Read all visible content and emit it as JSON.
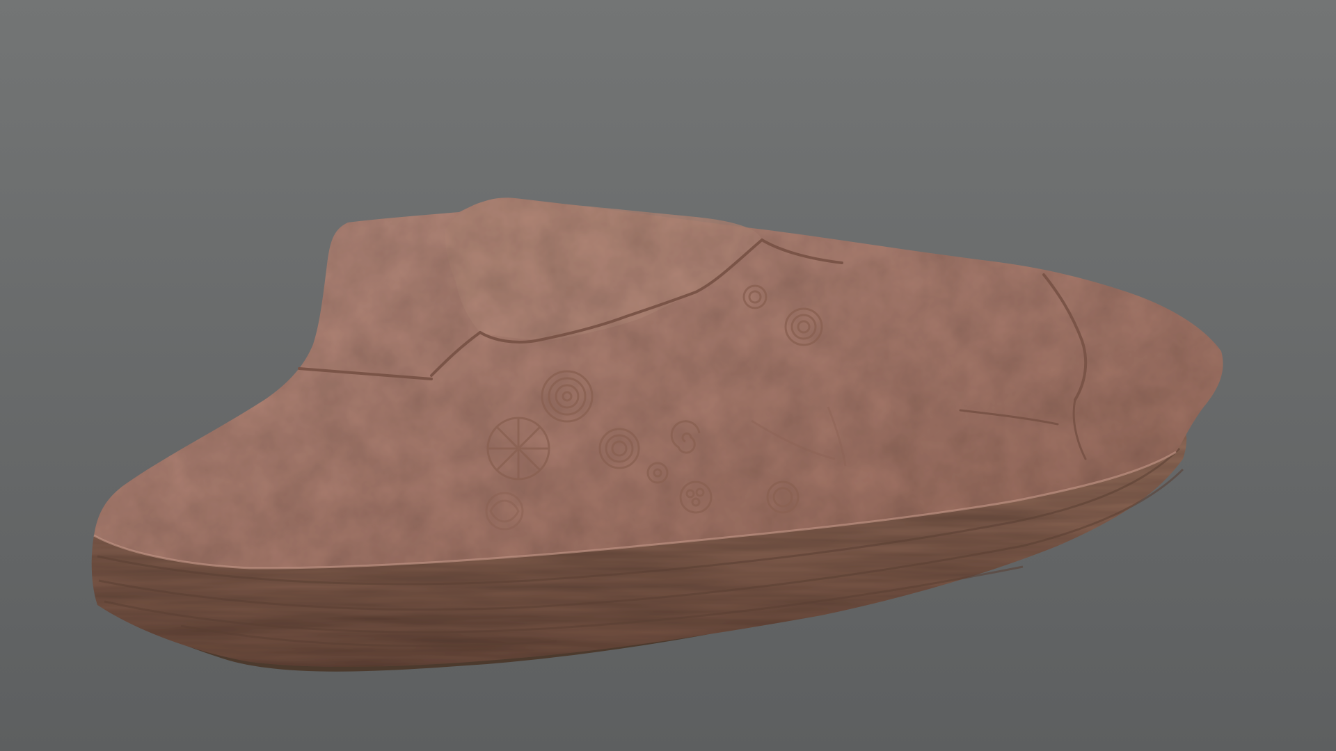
{
  "scene": {
    "subject": "rock-slab",
    "carvings": [
      "concentric-circles",
      "spiral",
      "wheel-cross"
    ],
    "colors": {
      "background_top": "#737575",
      "background_bottom": "#5d5f60",
      "rock_top_light": "#b58a7c",
      "rock_top_mid": "#a6796b",
      "rock_top_dark": "#946758",
      "rock_side_light": "#9a725f",
      "rock_side_dark": "#6b4a3c",
      "rock_base": "#4c3a2d",
      "crack": "#7a5447",
      "carving_line": "#8b6253"
    }
  }
}
